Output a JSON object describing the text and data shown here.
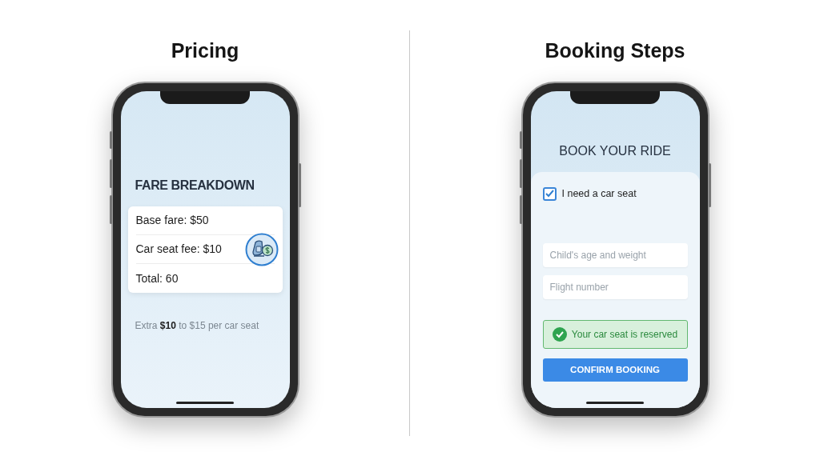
{
  "panels": [
    {
      "kind": "pricing",
      "heading": "Pricing",
      "screen_title": "FARE BREAKDOWN",
      "fare_lines": [
        "Base fare: $50",
        "Car seat fee: $10",
        "Total: 60"
      ],
      "note": "Extra **$10** to $15 per car seat"
    },
    {
      "kind": "booking",
      "heading": "Booking Steps",
      "screen_title": "BOOK YOUR RIDE",
      "checkbox": {
        "label": "I need a car seat",
        "checked": true
      },
      "fields": [
        {
          "placeholder": "Child's age and weight"
        },
        {
          "placeholder": "Flight number"
        }
      ],
      "alert": "Your car seat is reserved",
      "button": "CONFIRM BOOKING"
    }
  ]
}
